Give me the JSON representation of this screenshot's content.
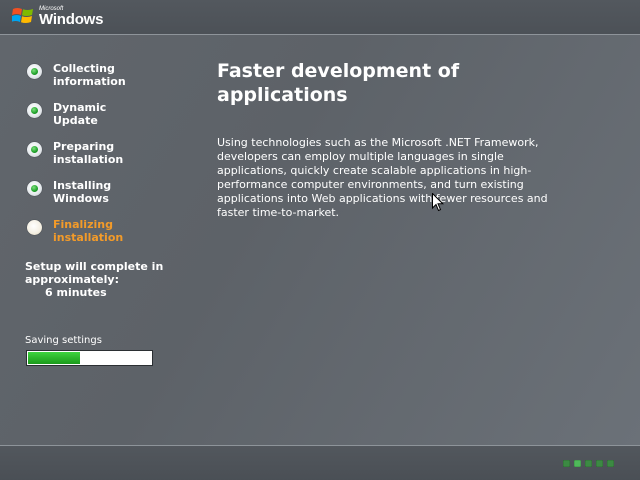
{
  "branding": {
    "microsoft_text": "Microsoft",
    "windows_text": "Windows",
    "flag_colors": [
      "#f25022",
      "#7fba00",
      "#00a4ef",
      "#ffb900"
    ]
  },
  "steps": [
    {
      "line1": "Collecting",
      "line2": "information",
      "state": "done"
    },
    {
      "line1": "Dynamic",
      "line2": "Update",
      "state": "done"
    },
    {
      "line1": "Preparing",
      "line2": "installation",
      "state": "done"
    },
    {
      "line1": "Installing",
      "line2": "Windows",
      "state": "done"
    },
    {
      "line1": "Finalizing",
      "line2": "installation",
      "state": "current"
    }
  ],
  "remaining": {
    "line1": "Setup will complete in",
    "line2": "approximately:",
    "minutes": "6 minutes"
  },
  "progress": {
    "label": "Saving settings",
    "fraction": 0.43
  },
  "main": {
    "title_line1": "Faster development of",
    "title_line2": "applications",
    "body": "Using technologies such as the Microsoft .NET Framework, developers can employ multiple languages in single applications, quickly create scalable applications in high-performance computer environments, and turn existing applications into Web applications with fewer resources and faster time-to-market."
  },
  "marquee": {
    "squares": 5,
    "active_index": 1
  },
  "colors": {
    "current_step": "#f39b29",
    "done_dot": "#1fa12a",
    "progress_fill": "#2bb52b"
  }
}
